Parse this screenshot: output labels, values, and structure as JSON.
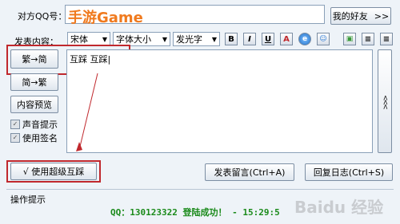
{
  "header": {
    "qq_label": "对方QQ号：",
    "qq_value": "手游Game",
    "my_friends_button": "我的好友",
    "expand_button": ">>"
  },
  "toolbar": {
    "content_label": "发表内容：",
    "font_family": "宋体",
    "font_size": "字体大小",
    "font_effect": "发光字",
    "bold": "B",
    "italic": "I",
    "underline": "U",
    "color": "A",
    "align_center": "≡",
    "align_right": "≡"
  },
  "left_panel": {
    "trad_to_simp": "繁→简",
    "simp_to_trad": "简→繁",
    "preview": "内容预览",
    "sound_prompt": "声音提示",
    "use_signature": "使用签名"
  },
  "editor": {
    "text": "互踩 互踩|"
  },
  "side_collapse": "<<<",
  "bottom": {
    "super_button": "√ 使用超级互踩",
    "post_button": "发表留言(Ctrl+A)",
    "reply_button": "回复日志(Ctrl+S)",
    "ops_label": "操作提示",
    "status": "QQ：130123322 登陆成功！ - 15:29:5"
  },
  "watermark": "Baidu 经验",
  "colors": {
    "accent_orange": "#f07a1e",
    "status_green": "#1a8a1a",
    "highlight_red": "#c0282d"
  }
}
